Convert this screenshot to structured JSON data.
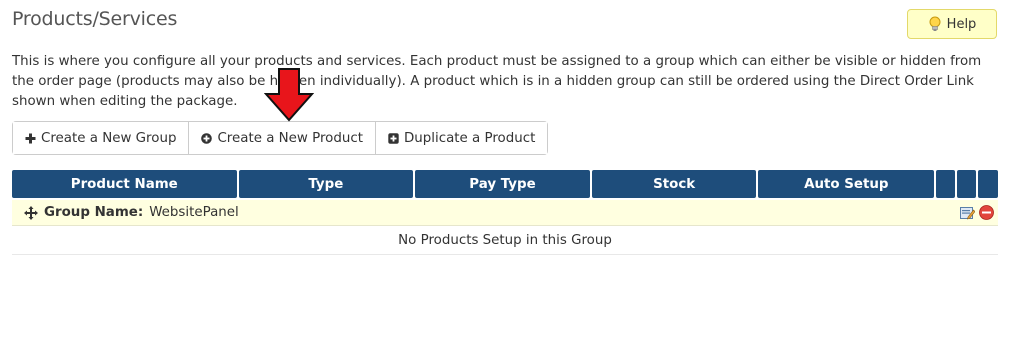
{
  "page": {
    "title": "Products/Services",
    "help_label": "Help",
    "intro": "This is where you configure all your products and services. Each product must be assigned to a group which can either be visible or hidden from the order page (products may also be hidden individually). A product which is in a hidden group can still be ordered using the Direct Order Link shown when editing the package."
  },
  "toolbar": {
    "buttons": [
      {
        "label": "Create a New Group",
        "icon": "plus-icon"
      },
      {
        "label": "Create a New Product",
        "icon": "plus-circle-icon"
      },
      {
        "label": "Duplicate a Product",
        "icon": "plus-square-icon"
      }
    ]
  },
  "table": {
    "columns": [
      "Product Name",
      "Type",
      "Pay Type",
      "Stock",
      "Auto Setup"
    ],
    "group": {
      "label": "Group Name:",
      "name": "WebsitePanel",
      "actions": [
        "edit-icon",
        "delete-icon"
      ]
    },
    "empty_message": "No Products Setup in this Group"
  },
  "annotation": {
    "icon": "red-down-arrow",
    "color": "#e8151b"
  },
  "colors": {
    "header_bg": "#1e4d7b",
    "group_row_bg": "#ffffe0",
    "help_bg": "#ffffc8"
  }
}
